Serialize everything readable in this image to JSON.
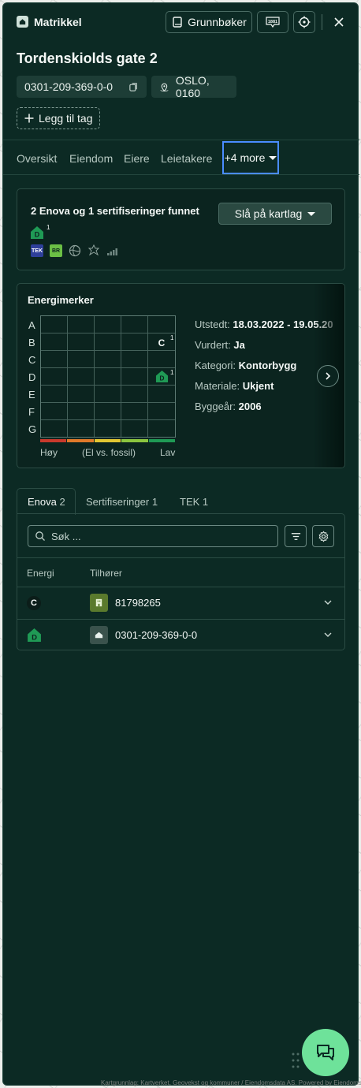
{
  "app": {
    "title": "Matrikkel",
    "icon": "house-icon"
  },
  "header": {
    "grunnboker_label": "Grunnbøker",
    "phone_badge": "1881"
  },
  "property": {
    "title": "Tordenskiolds gate 2",
    "id": "0301-209-369-0-0",
    "city": "OSLO, 0160",
    "add_tag_label": "Legg til tag"
  },
  "tabs": {
    "items": [
      "Oversikt",
      "Eiendom",
      "Eiere",
      "Leietakere"
    ],
    "more_label": "+4 more"
  },
  "enova_card": {
    "title": "2 Enova og 1 sertifiseringer funnet",
    "map_layer_label": "Slå på kartlag",
    "badge_grade": "D",
    "badge_count": "1",
    "logos": [
      "TEK",
      "BR"
    ]
  },
  "energy": {
    "title": "Energimerker",
    "grades": [
      "A",
      "B",
      "C",
      "D",
      "E",
      "F",
      "G"
    ],
    "markers": [
      {
        "grade": "C",
        "count": "1"
      },
      {
        "grade": "D",
        "count": "1"
      }
    ],
    "scale_left": "Høy",
    "scale_mid": "(El vs. fossil)",
    "scale_right": "Lav",
    "scale_colors": [
      "#c83a2c",
      "#e07a2a",
      "#e2c733",
      "#8bc53f",
      "#1f9a55"
    ],
    "info": {
      "issued_label": "Utstedt:",
      "issued_value": "18.03.2022 - 19.05.20",
      "rated_label": "Vurdert:",
      "rated_value": "Ja",
      "category_label": "Kategori:",
      "category_value": "Kontorbygg",
      "material_label": "Materiale:",
      "material_value": "Ukjent",
      "year_label": "Byggeår:",
      "year_value": "2006"
    }
  },
  "subtabs": {
    "enova_label": "Enova",
    "enova_count": "2",
    "cert_label": "Sertifiseringer",
    "cert_count": "1",
    "tek_label": "TEK",
    "tek_count": "1"
  },
  "table": {
    "search_placeholder": "Søk ...",
    "col_energy": "Energi",
    "col_owner": "Tilhører",
    "rows": [
      {
        "grade": "C",
        "owner": "81798265"
      },
      {
        "grade": "D",
        "owner": "0301-209-369-0-0"
      }
    ]
  },
  "footer": {
    "attribution": "Kartgrunnlag: Kartverket, Geovekst og kommuner / Eiendomsdata AS. Powered by Eiendomsverdi"
  },
  "colors": {
    "panel_bg": "#0c2a24",
    "accent_green": "#6ee29a",
    "focus_blue": "#4a8cff",
    "grade_d_green": "#1f9a55"
  }
}
